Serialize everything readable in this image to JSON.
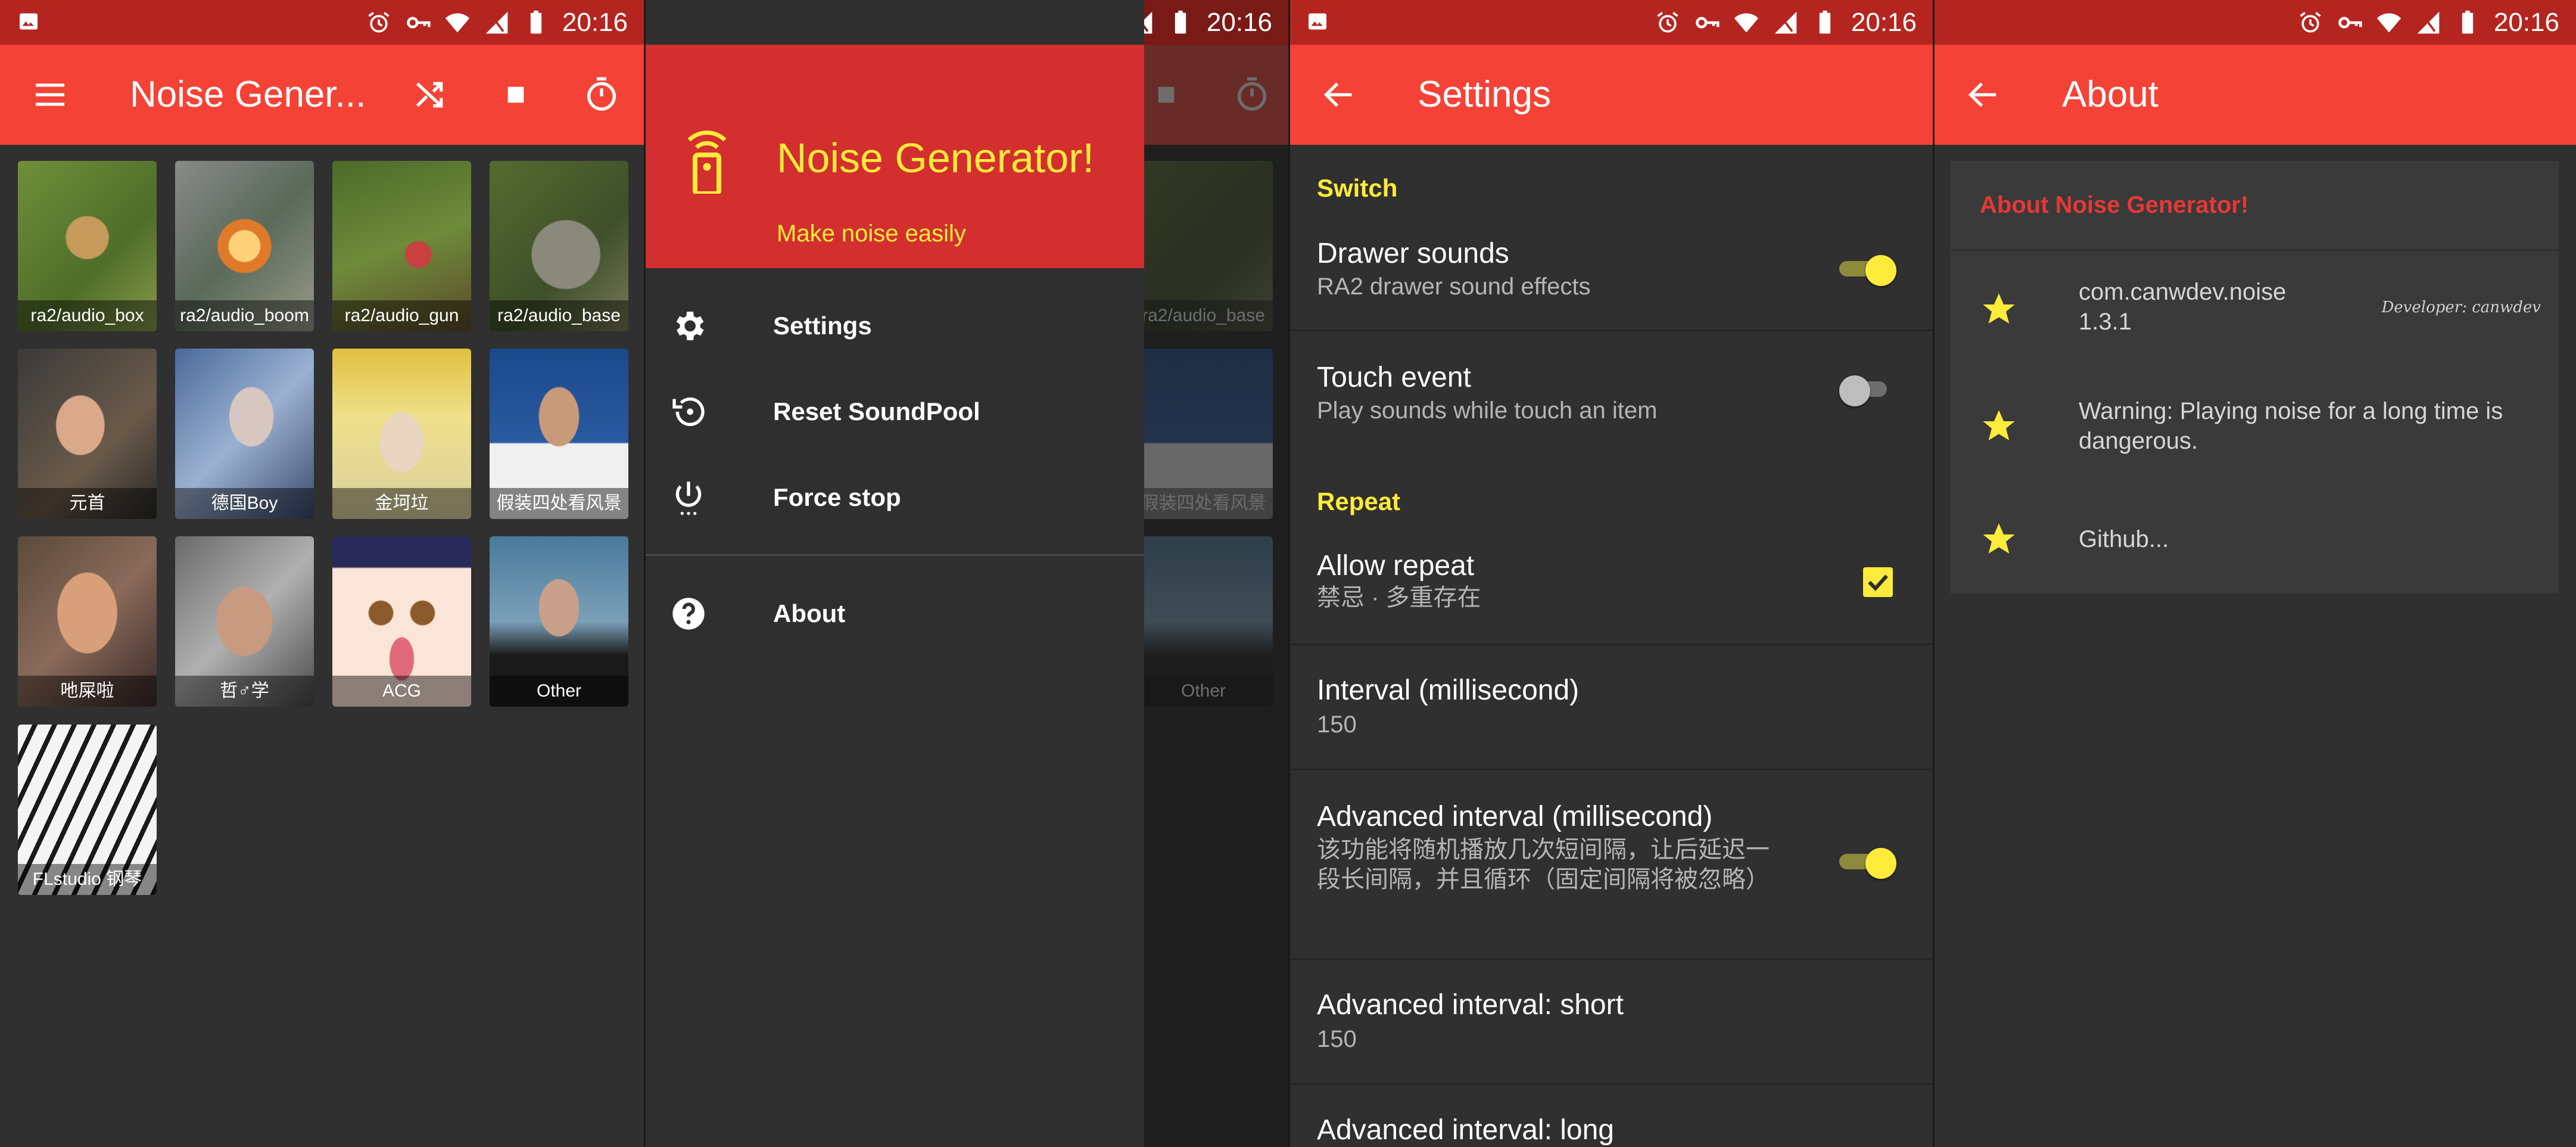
{
  "statusbar": {
    "time": "20:16"
  },
  "colors": {
    "primary": "#f44336",
    "primary_dark": "#b52520",
    "accent": "#ffeb3b",
    "background": "#303030"
  },
  "main_screen": {
    "title": "Noise Gener...",
    "actions": [
      "shuffle-icon",
      "stop-icon",
      "timer-icon"
    ],
    "tiles": [
      {
        "label": "ra2/audio_box"
      },
      {
        "label": "ra2/audio_boom"
      },
      {
        "label": "ra2/audio_gun"
      },
      {
        "label": "ra2/audio_base"
      },
      {
        "label": "元首"
      },
      {
        "label": "德国Boy"
      },
      {
        "label": "金坷垃"
      },
      {
        "label": "假装四处看风景"
      },
      {
        "label": "吔屎啦"
      },
      {
        "label": "哲♂学"
      },
      {
        "label": "ACG"
      },
      {
        "label": "Other"
      },
      {
        "label": "FLstudio 钢琴"
      }
    ]
  },
  "drawer": {
    "app_name": "Noise Generator!",
    "tagline": "Make noise easily",
    "items": [
      {
        "label": "Settings",
        "icon": "gear-icon"
      },
      {
        "label": "Reset SoundPool",
        "icon": "restore-icon"
      },
      {
        "label": "Force stop",
        "icon": "power-icon"
      },
      {
        "label": "About",
        "icon": "help-icon"
      }
    ]
  },
  "settings": {
    "title": "Settings",
    "categories": {
      "switch": "Switch",
      "repeat": "Repeat"
    },
    "drawer_sounds": {
      "title": "Drawer sounds",
      "summary": "RA2 drawer sound effects",
      "on": true
    },
    "touch_event": {
      "title": "Touch event",
      "summary": "Play sounds while touch an item",
      "on": false
    },
    "allow_repeat": {
      "title": "Allow repeat",
      "summary": "禁忌 · 多重存在",
      "checked": true
    },
    "interval": {
      "title": "Interval (millisecond)",
      "summary": "150"
    },
    "advanced_interval": {
      "title": "Advanced interval (millisecond)",
      "summary": "该功能将随机播放几次短间隔，让后延迟一段长间隔，并且循环（固定间隔将被忽略）",
      "on": true
    },
    "advanced_short": {
      "title": "Advanced interval: short",
      "summary": "150"
    },
    "advanced_long": {
      "title": "Advanced interval: long"
    }
  },
  "about": {
    "title": "About",
    "card_title": "About Noise Generator!",
    "package": "com.canwdev.noise",
    "version": "1.3.1",
    "developer_signature": "Developer: canwdev",
    "warning": "Warning: Playing noise for a long time is dangerous.",
    "github": "Github..."
  }
}
